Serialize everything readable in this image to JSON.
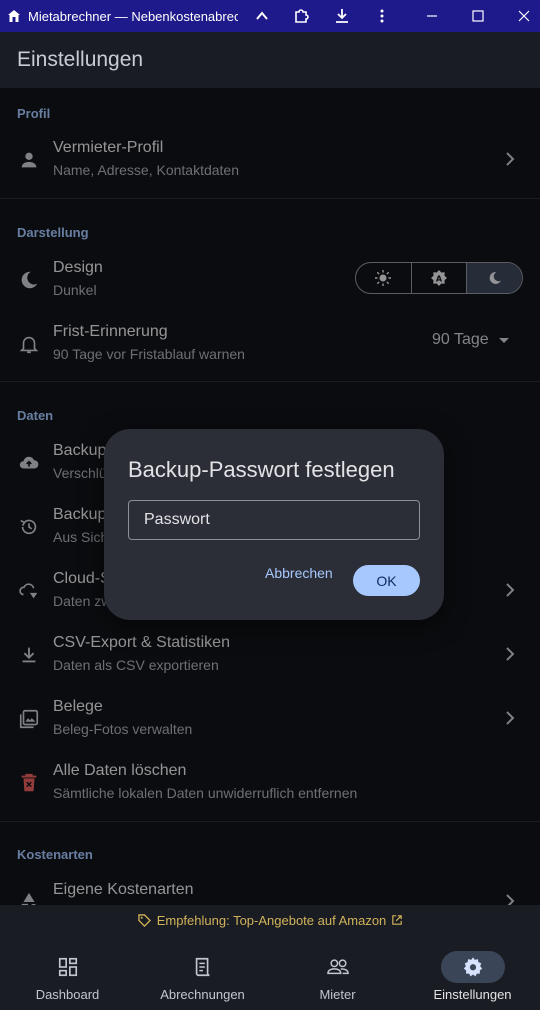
{
  "window": {
    "title": "Mietabrechner — Nebenkostenabrec..."
  },
  "appbar": {
    "title": "Einstellungen"
  },
  "sections": {
    "profil": "Profil",
    "darstellung": "Darstellung",
    "daten": "Daten",
    "kostenarten": "Kostenarten"
  },
  "rows": {
    "vermieter": {
      "title": "Vermieter-Profil",
      "subtitle": "Name, Adresse, Kontaktdaten"
    },
    "design": {
      "title": "Design",
      "subtitle": "Dunkel"
    },
    "frist": {
      "title": "Frist-Erinnerung",
      "subtitle": "90 Tage vor Fristablauf warnen",
      "value": "90 Tage"
    },
    "backup1": {
      "title": "Backup",
      "subtitle": "Verschlü"
    },
    "backup2": {
      "title": "Backup",
      "subtitle": "Aus Sich"
    },
    "cloud": {
      "title": "Cloud-S",
      "subtitle": "Daten zw"
    },
    "csv": {
      "title": "CSV-Export & Statistiken",
      "subtitle": "Daten als CSV exportieren"
    },
    "belege": {
      "title": "Belege",
      "subtitle": "Beleg-Fotos verwalten"
    },
    "loeschen": {
      "title": "Alle Daten löschen",
      "subtitle": "Sämtliche lokalen Daten unwiderruflich entfernen"
    },
    "eigene": {
      "title": "Eigene Kostenarten"
    }
  },
  "dialog": {
    "title": "Backup-Passwort festlegen",
    "placeholder": "Passwort",
    "cancel": "Abbrechen",
    "ok": "OK"
  },
  "promo": {
    "text": "Empfehlung: Top-Angebote auf Amazon"
  },
  "nav": {
    "dashboard": "Dashboard",
    "abrechnungen": "Abrechnungen",
    "mieter": "Mieter",
    "einstellungen": "Einstellungen"
  },
  "colors": {
    "accent": "#a7c8ff",
    "titlebar": "#1f1a8c",
    "danger": "#e35d5b",
    "promo": "#d1b35a"
  }
}
